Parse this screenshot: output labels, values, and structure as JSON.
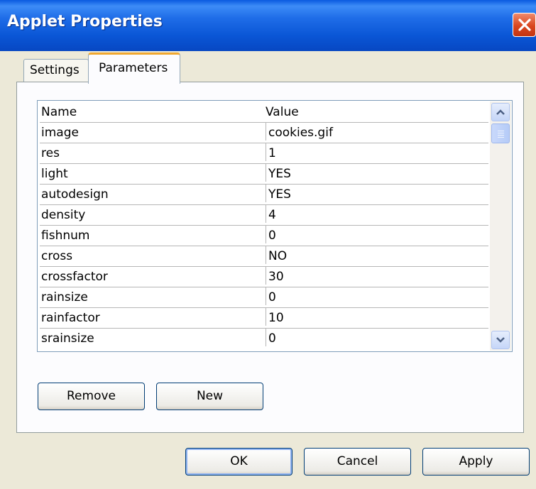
{
  "window": {
    "title": "Applet Properties"
  },
  "tabs": [
    {
      "label": "Settings",
      "active": false
    },
    {
      "label": "Parameters",
      "active": true
    }
  ],
  "table": {
    "columns": [
      "Name",
      "Value"
    ],
    "rows": [
      {
        "name": "image",
        "value": "cookies.gif"
      },
      {
        "name": "res",
        "value": "1"
      },
      {
        "name": "light",
        "value": "YES"
      },
      {
        "name": "autodesign",
        "value": "YES"
      },
      {
        "name": "density",
        "value": "4"
      },
      {
        "name": "fishnum",
        "value": "0"
      },
      {
        "name": "cross",
        "value": "NO"
      },
      {
        "name": "crossfactor",
        "value": "30"
      },
      {
        "name": "rainsize",
        "value": "0"
      },
      {
        "name": "rainfactor",
        "value": "10"
      },
      {
        "name": "srainsize",
        "value": "0"
      }
    ]
  },
  "buttons": {
    "remove": "Remove",
    "new": "New",
    "ok": "OK",
    "cancel": "Cancel",
    "apply": "Apply"
  },
  "colors": {
    "titlebar": "#0a56d6",
    "close": "#d9461f",
    "tab_highlight": "#f0a830",
    "dialog_bg": "#ece9d8"
  }
}
